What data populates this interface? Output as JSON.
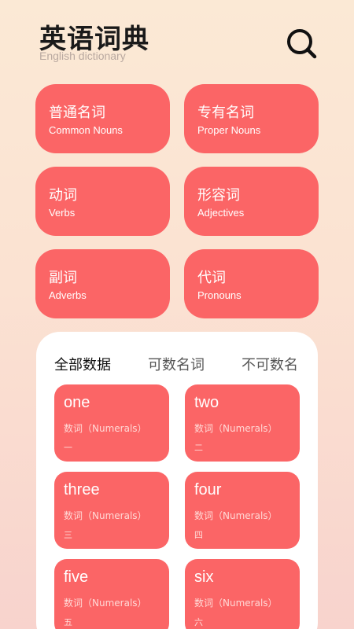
{
  "header": {
    "title": "英语词典",
    "subtitle": "English dictionary",
    "search_icon": "search-icon"
  },
  "categories": [
    {
      "zh": "普通名词",
      "en": "Common Nouns"
    },
    {
      "zh": "专有名词",
      "en": "Proper Nouns"
    },
    {
      "zh": "动词",
      "en": "Verbs"
    },
    {
      "zh": "形容词",
      "en": "Adjectives"
    },
    {
      "zh": "副词",
      "en": "Adverbs"
    },
    {
      "zh": "代词",
      "en": "Pronouns"
    }
  ],
  "tabs": [
    {
      "label": "全部数据",
      "active": true
    },
    {
      "label": "可数名词",
      "active": false
    },
    {
      "label": "不可数名",
      "active": false
    }
  ],
  "words": [
    {
      "word": "one",
      "type": "数词（Numerals）",
      "meaning": "一"
    },
    {
      "word": "two",
      "type": "数词（Numerals）",
      "meaning": "二"
    },
    {
      "word": "three",
      "type": "数词（Numerals）",
      "meaning": "三"
    },
    {
      "word": "four",
      "type": "数词（Numerals）",
      "meaning": "四"
    },
    {
      "word": "five",
      "type": "数词（Numerals）",
      "meaning": "五"
    },
    {
      "word": "six",
      "type": "数词（Numerals）",
      "meaning": "六"
    }
  ],
  "colors": {
    "accent": "#fb6566",
    "panel": "#ffffff"
  }
}
